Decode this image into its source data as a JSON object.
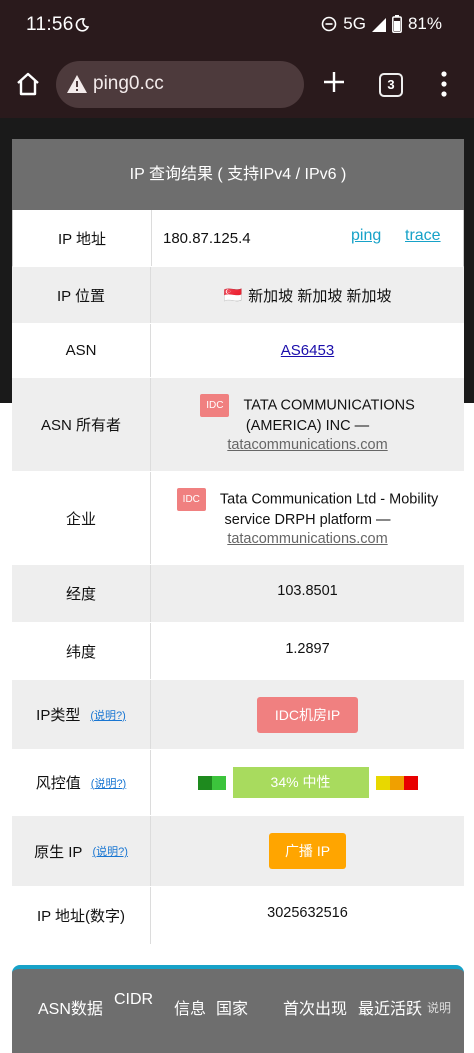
{
  "status": {
    "time": "11:56",
    "network": "5G",
    "battery": "81%"
  },
  "browser": {
    "url": "ping0.cc",
    "tab_count": "3"
  },
  "table": {
    "header": "IP 查询结果 ( 支持IPv4 / IPv6 )",
    "ip": {
      "label": "IP 地址",
      "value": "180.87.125.4",
      "ping": "ping",
      "trace": "trace"
    },
    "location": {
      "label": "IP 位置",
      "flag": "🇸🇬",
      "value": "新加坡 新加坡 新加坡"
    },
    "asn": {
      "label": "ASN",
      "value": "AS6453"
    },
    "asn_owner": {
      "label": "ASN 所有者",
      "tag": "IDC",
      "name": "TATA COMMUNICATIONS (AMERICA) INC —",
      "domain": "tatacommunications.com"
    },
    "enterprise": {
      "label": "企业",
      "tag": "IDC",
      "name": "Tata Communication Ltd - Mobility service DRPH platform —",
      "domain": "tatacommunications.com"
    },
    "longitude": {
      "label": "经度",
      "value": "103.8501"
    },
    "latitude": {
      "label": "纬度",
      "value": "1.2897"
    },
    "ip_type": {
      "label": "IP类型",
      "explain": "(说明?)",
      "value": "IDC机房IP"
    },
    "risk": {
      "label": "风控值",
      "explain": "(说明?)",
      "value": "34%  中性",
      "score_percent": 34,
      "colors": {
        "left1": "#1e8a1e",
        "left2": "#3cc43c",
        "right1": "#e8d800",
        "right2": "#f0a000",
        "right3": "#e80000",
        "bar": "#a8db5e"
      }
    },
    "native": {
      "label": "原生 IP",
      "explain": "(说明?)",
      "value": "广播 IP"
    },
    "ip_numeric": {
      "label": "IP 地址(数字)",
      "value": "3025632516"
    }
  },
  "asn_table": {
    "columns": [
      "ASN数据",
      "CIDR",
      "信息",
      "国家",
      "首次出现",
      "最近活跃",
      "说明"
    ]
  }
}
